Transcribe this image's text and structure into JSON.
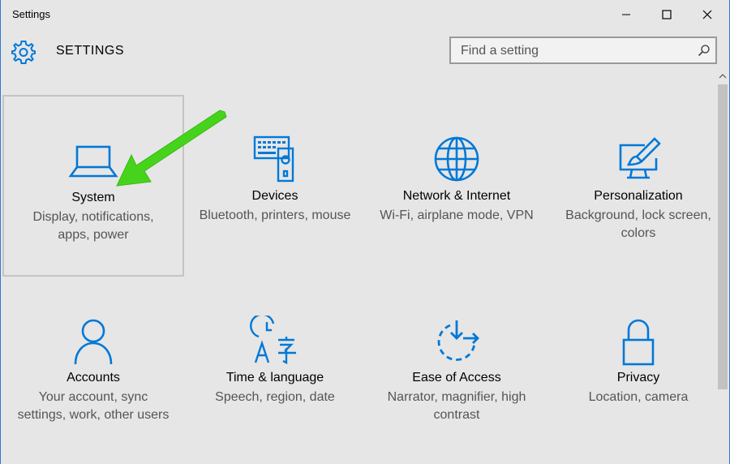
{
  "window": {
    "title": "Settings"
  },
  "header": {
    "title": "SETTINGS",
    "icon": "gear-icon"
  },
  "search": {
    "placeholder": "Find a setting",
    "value": ""
  },
  "colors": {
    "accent": "#0078d7",
    "annotation_arrow": "#45d41b"
  },
  "tiles": [
    {
      "name": "System",
      "desc": "Display, notifications, apps, power",
      "icon": "laptop-icon",
      "selected": true
    },
    {
      "name": "Devices",
      "desc": "Bluetooth, printers, mouse",
      "icon": "devices-icon"
    },
    {
      "name": "Network & Internet",
      "desc": "Wi-Fi, airplane mode, VPN",
      "icon": "globe-icon"
    },
    {
      "name": "Personalization",
      "desc": "Background, lock screen, colors",
      "icon": "paint-icon"
    },
    {
      "name": "Accounts",
      "desc": "Your account, sync settings, work, other users",
      "icon": "person-icon"
    },
    {
      "name": "Time & language",
      "desc": "Speech, region, date",
      "icon": "time-language-icon"
    },
    {
      "name": "Ease of Access",
      "desc": "Narrator, magnifier, high contrast",
      "icon": "ease-of-access-icon"
    },
    {
      "name": "Privacy",
      "desc": "Location, camera",
      "icon": "lock-icon"
    }
  ]
}
